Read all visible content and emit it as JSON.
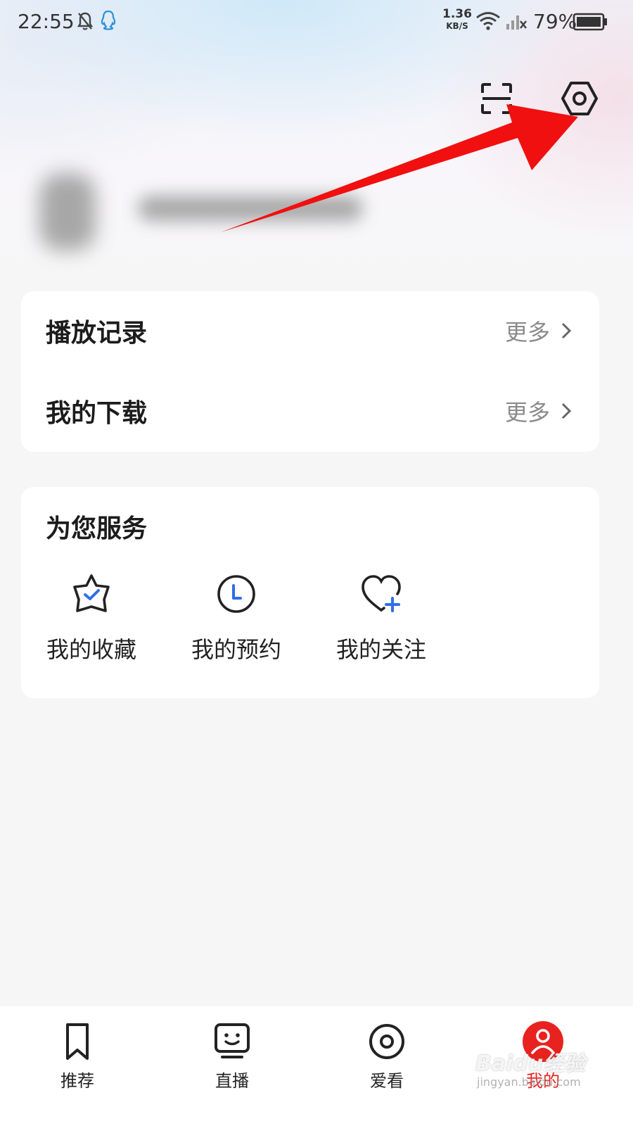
{
  "status_bar": {
    "time": "22:55",
    "net_speed_value": "1.36",
    "net_speed_unit": "KB/S",
    "battery": "79%",
    "icons": [
      "bell-off-icon",
      "qq-icon",
      "wifi-icon",
      "signal-icon",
      "battery-icon"
    ]
  },
  "header": {
    "icons": [
      "scan-icon",
      "settings-icon"
    ]
  },
  "history": {
    "rows": [
      {
        "title": "播放记录",
        "more": "更多"
      },
      {
        "title": "我的下载",
        "more": "更多"
      }
    ]
  },
  "services": {
    "title": "为您服务",
    "items": [
      {
        "label": "我的收藏",
        "icon": "star-check-icon"
      },
      {
        "label": "我的预约",
        "icon": "clock-icon"
      },
      {
        "label": "我的关注",
        "icon": "heart-plus-icon"
      }
    ]
  },
  "bottom_nav": {
    "items": [
      {
        "label": "推荐",
        "icon": "bookmark-icon",
        "active": false
      },
      {
        "label": "直播",
        "icon": "tv-icon",
        "active": false
      },
      {
        "label": "爱看",
        "icon": "target-icon",
        "active": false
      },
      {
        "label": "我的",
        "icon": "profile-icon",
        "active": true
      }
    ]
  },
  "colors": {
    "accent": "#e8231f",
    "annotation": "#f01010",
    "service_icon_accent": "#2f6fe8"
  },
  "watermark": {
    "brand": "Baidu经验",
    "url": "jingyan.baidu.com"
  }
}
